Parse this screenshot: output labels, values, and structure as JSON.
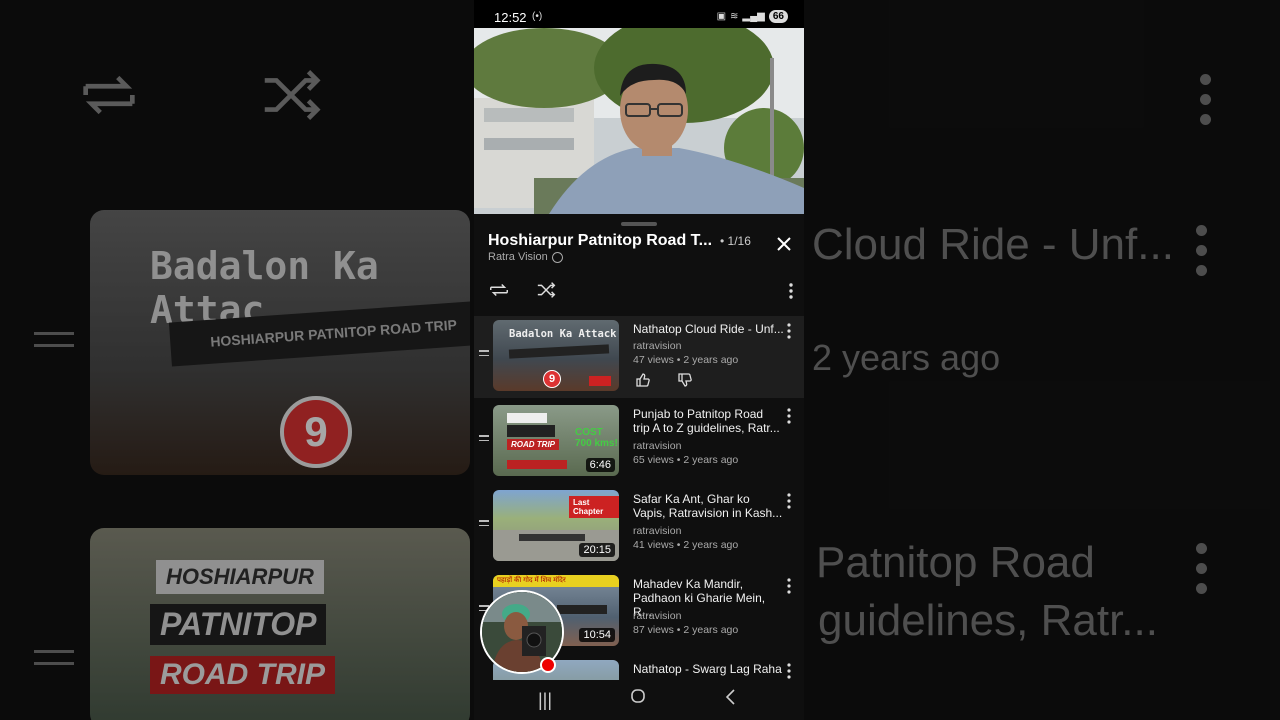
{
  "status_bar": {
    "time": "12:52",
    "battery": "66"
  },
  "playlist": {
    "title": "Hoshiarpur Patnitop Road T...",
    "position": "1/16",
    "channel": "Ratra Vision"
  },
  "items": [
    {
      "title": "Nathatop Cloud Ride - Unf...",
      "channel": "ratravision",
      "meta": "47 views • 2 years ago",
      "duration": "",
      "thumb_text": "Badalon Ka Attack",
      "active": true
    },
    {
      "title": "Punjab to Patnitop Road trip A to Z guidelines, Ratr...",
      "channel": "ratravision",
      "meta": "65 views • 2 years ago",
      "duration": "6:46",
      "thumb_text": "ROAD TRIP",
      "active": false
    },
    {
      "title": "Safar Ka Ant, Ghar ko Vapis, Ratravision in Kash...",
      "channel": "ratravision",
      "meta": "41 views • 2 years ago",
      "duration": "20:15",
      "thumb_text": "Last Chapter",
      "active": false
    },
    {
      "title": "Mahadev Ka Mandir, Padhaon ki Gharie Mein, R...",
      "channel": "ratravision",
      "meta": "87 views • 2 years ago",
      "duration": "10:54",
      "thumb_text": "पहाड़ों की गोद में शिव मंदिर",
      "active": false
    },
    {
      "title": "Nathatop - Swarg Lag Raha",
      "channel": "",
      "meta": "",
      "duration": "",
      "thumb_text": "",
      "active": false
    }
  ],
  "background": {
    "text_1": "Cloud Ride - Unf...",
    "text_2": "2 years ago",
    "text_3": "Patnitop Road",
    "text_4": "guidelines, Ratr...",
    "card_text_1": "Badalon Ka Attac",
    "card_text_2": "HOSHIARPUR PATNITOP ROAD TRIP",
    "card_text_3": "HOSHIARPUR",
    "card_text_4": "PATNITOP",
    "card_text_5": "ROAD TRIP"
  },
  "colors": {
    "accent_red": "#e00000",
    "sheet_bg": "#0f0f0f"
  }
}
